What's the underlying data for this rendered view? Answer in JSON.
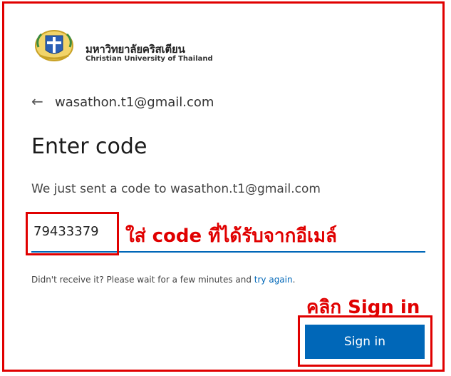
{
  "org": {
    "name_th": "มหาวิทยาลัยคริสเตียน",
    "name_en": "Christian University of Thailand"
  },
  "account": {
    "email": "wasathon.t1@gmail.com"
  },
  "page": {
    "title": "Enter code",
    "description": "We just sent a code to wasathon.t1@gmail.com"
  },
  "code_input": {
    "value": "79433379"
  },
  "resend": {
    "text": "Didn't receive it? Please wait for a few minutes and ",
    "link": "try again",
    "suffix": "."
  },
  "button": {
    "signin_label": "Sign in"
  },
  "annotations": {
    "enter_code": "ใส่ code ที่ได้รับจากอีเมล์",
    "click_signin": "คลิก Sign in"
  },
  "colors": {
    "accent": "#0067b8",
    "annotation": "#e00000"
  }
}
